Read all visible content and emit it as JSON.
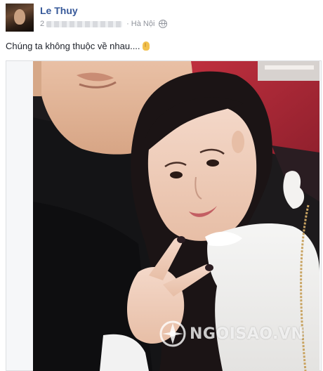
{
  "post": {
    "author": "Le Thuy",
    "date_prefix": "2",
    "location": "Hà Nội",
    "location_separator": "·",
    "message": "Chúng ta không thuộc về nhau....",
    "privacy_icon": "globe-icon",
    "emoji_icon": "ok-hand-icon"
  },
  "watermark": {
    "text": "NGOISAO.VN"
  },
  "colors": {
    "author": "#365899",
    "meta": "#90949c",
    "text": "#1d2129"
  }
}
